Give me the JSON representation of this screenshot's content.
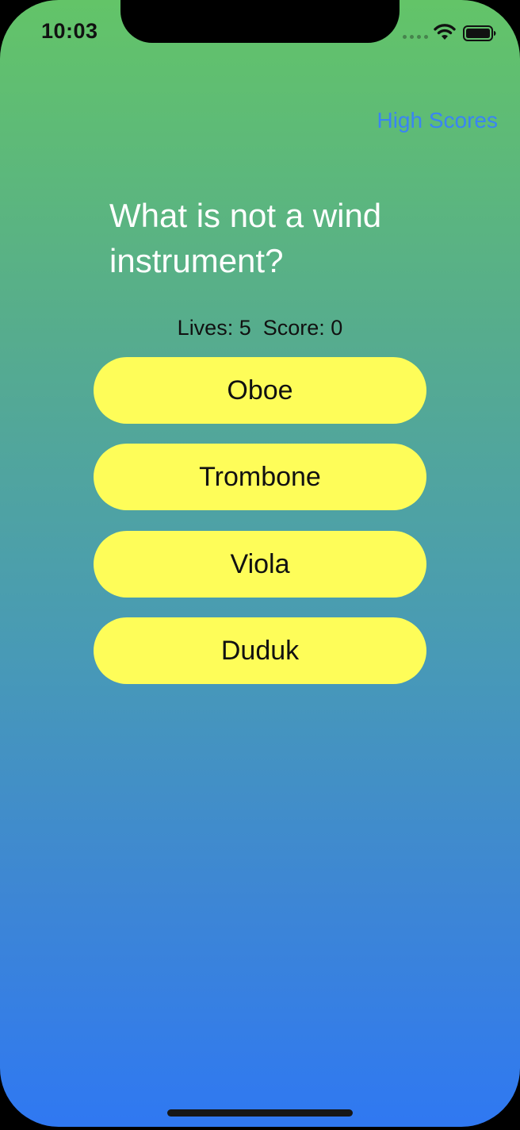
{
  "status_bar": {
    "time": "10:03",
    "icons": [
      "signal-dots-icon",
      "wifi-icon",
      "battery-icon"
    ]
  },
  "nav": {
    "high_scores_label": "High Scores"
  },
  "quiz": {
    "question": "What is not a wind instrument?",
    "lives_label": "Lives: 5",
    "score_label": "Score: 0",
    "answers": [
      {
        "label": "Oboe"
      },
      {
        "label": "Trombone"
      },
      {
        "label": "Viola"
      },
      {
        "label": "Duduk"
      }
    ]
  },
  "colors": {
    "gradient_top": "#63c468",
    "gradient_bottom": "#2f78f2",
    "answer_button": "#fefd59",
    "link": "#3a84f4",
    "question_text": "#ffffff"
  }
}
